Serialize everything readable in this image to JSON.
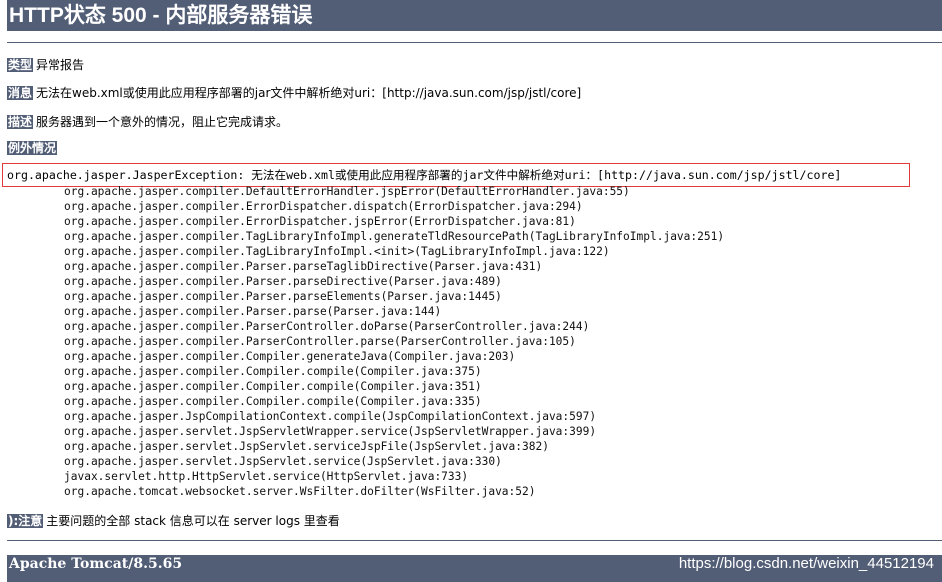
{
  "page": {
    "title": "HTTP状态 500 - 内部服务器错误"
  },
  "report": {
    "type_label": "类型",
    "type_value": "异常报告",
    "message_label": "消息",
    "message_value": "无法在web.xml或使用此应用程序部署的jar文件中解析绝对uri：[http://java.sun.com/jsp/jstl/core]",
    "description_label": "描述",
    "description_value": "服务器遇到一个意外的情况，阻止它完成请求。",
    "exception_heading": "例外情况",
    "exception_line": "org.apache.jasper.JasperException: 无法在web.xml或使用此应用程序部署的jar文件中解析绝对uri：[http://java.sun.com/jsp/jstl/core]",
    "stack_trace": [
      "org.apache.jasper.compiler.DefaultErrorHandler.jspError(DefaultErrorHandler.java:55)",
      "org.apache.jasper.compiler.ErrorDispatcher.dispatch(ErrorDispatcher.java:294)",
      "org.apache.jasper.compiler.ErrorDispatcher.jspError(ErrorDispatcher.java:81)",
      "org.apache.jasper.compiler.TagLibraryInfoImpl.generateTldResourcePath(TagLibraryInfoImpl.java:251)",
      "org.apache.jasper.compiler.TagLibraryInfoImpl.<init>(TagLibraryInfoImpl.java:122)",
      "org.apache.jasper.compiler.Parser.parseTaglibDirective(Parser.java:431)",
      "org.apache.jasper.compiler.Parser.parseDirective(Parser.java:489)",
      "org.apache.jasper.compiler.Parser.parseElements(Parser.java:1445)",
      "org.apache.jasper.compiler.Parser.parse(Parser.java:144)",
      "org.apache.jasper.compiler.ParserController.doParse(ParserController.java:244)",
      "org.apache.jasper.compiler.ParserController.parse(ParserController.java:105)",
      "org.apache.jasper.compiler.Compiler.generateJava(Compiler.java:203)",
      "org.apache.jasper.compiler.Compiler.compile(Compiler.java:375)",
      "org.apache.jasper.compiler.Compiler.compile(Compiler.java:351)",
      "org.apache.jasper.compiler.Compiler.compile(Compiler.java:335)",
      "org.apache.jasper.JspCompilationContext.compile(JspCompilationContext.java:597)",
      "org.apache.jasper.servlet.JspServletWrapper.service(JspServletWrapper.java:399)",
      "org.apache.jasper.servlet.JspServlet.serviceJspFile(JspServlet.java:382)",
      "org.apache.jasper.servlet.JspServlet.service(JspServlet.java:330)",
      "javax.servlet.http.HttpServlet.service(HttpServlet.java:733)",
      "org.apache.tomcat.websocket.server.WsFilter.doFilter(WsFilter.java:52)"
    ],
    "note_label": "):注意",
    "note_value": "主要问题的全部 stack 信息可以在 server logs 里查看"
  },
  "footer": {
    "server": "Apache Tomcat/8.5.65",
    "watermark": "https://blog.csdn.net/weixin_44512194"
  },
  "colors": {
    "header_bg": "#525d76",
    "highlight_border": "#e03a3a"
  }
}
